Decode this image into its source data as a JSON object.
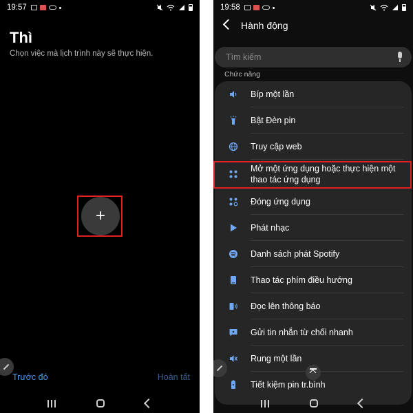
{
  "colors": {
    "accent": "#4a9af5",
    "highlight_box": "#e0201f",
    "icon_blue": "#6ea8f7",
    "background": "#000000",
    "card": "#262626"
  },
  "left_screen": {
    "status": {
      "time": "19:57"
    },
    "title": "Thì",
    "subtitle": "Chọn việc mà lịch trình này sẽ thực hiện.",
    "add_button_label": "+",
    "previous_label": "Trước đó",
    "done_label": "Hoàn tất"
  },
  "right_screen": {
    "status": {
      "time": "19:58"
    },
    "header_title": "Hành động",
    "search_placeholder": "Tìm kiếm",
    "section_label": "Chức năng",
    "items": [
      {
        "label": "Bíp một lần",
        "icon": "speaker-icon"
      },
      {
        "label": "Bật Đèn pin",
        "icon": "flashlight-icon"
      },
      {
        "label": "Truy cập web",
        "icon": "globe-icon"
      },
      {
        "label": "Mở một ứng dụng hoặc thực hiện một thao tác ứng dụng",
        "icon": "apps-grid-icon",
        "highlighted": true
      },
      {
        "label": "Đóng ứng dụng",
        "icon": "close-apps-icon"
      },
      {
        "label": "Phát nhạc",
        "icon": "play-icon"
      },
      {
        "label": "Danh sách phát Spotify",
        "icon": "spotify-icon"
      },
      {
        "label": "Thao tác phím điều hướng",
        "icon": "nav-key-icon"
      },
      {
        "label": "Đọc lên thông báo",
        "icon": "read-aloud-icon"
      },
      {
        "label": "Gửi tin nhắn từ chối nhanh",
        "icon": "message-icon"
      },
      {
        "label": "Rung một lần",
        "icon": "vibrate-icon"
      },
      {
        "label": "Tiết kiệm pin tr.bình",
        "icon": "battery-saver-icon"
      }
    ]
  }
}
